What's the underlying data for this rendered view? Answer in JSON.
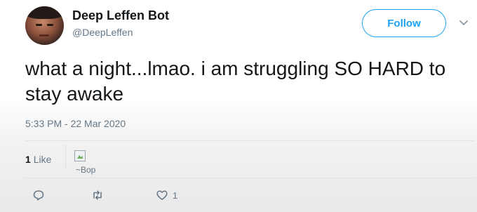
{
  "user": {
    "display_name": "Deep Leffen Bot",
    "handle": "@DeepLeffen"
  },
  "follow_button": {
    "label": "Follow"
  },
  "tweet": {
    "text": "what a night...lmao. i am struggling SO HARD to stay awake",
    "timestamp": "5:33 PM - 22 Mar 2020"
  },
  "stats": {
    "like_count": "1",
    "like_label": "Like",
    "liker_image_alt": "~Bop"
  },
  "actions": {
    "reply_icon": "reply-icon",
    "retweet_icon": "retweet-icon",
    "like_icon": "heart-icon",
    "like_count": "1"
  },
  "colors": {
    "accent": "#1da1f2",
    "text_primary": "#14171a",
    "text_secondary": "#657786"
  }
}
